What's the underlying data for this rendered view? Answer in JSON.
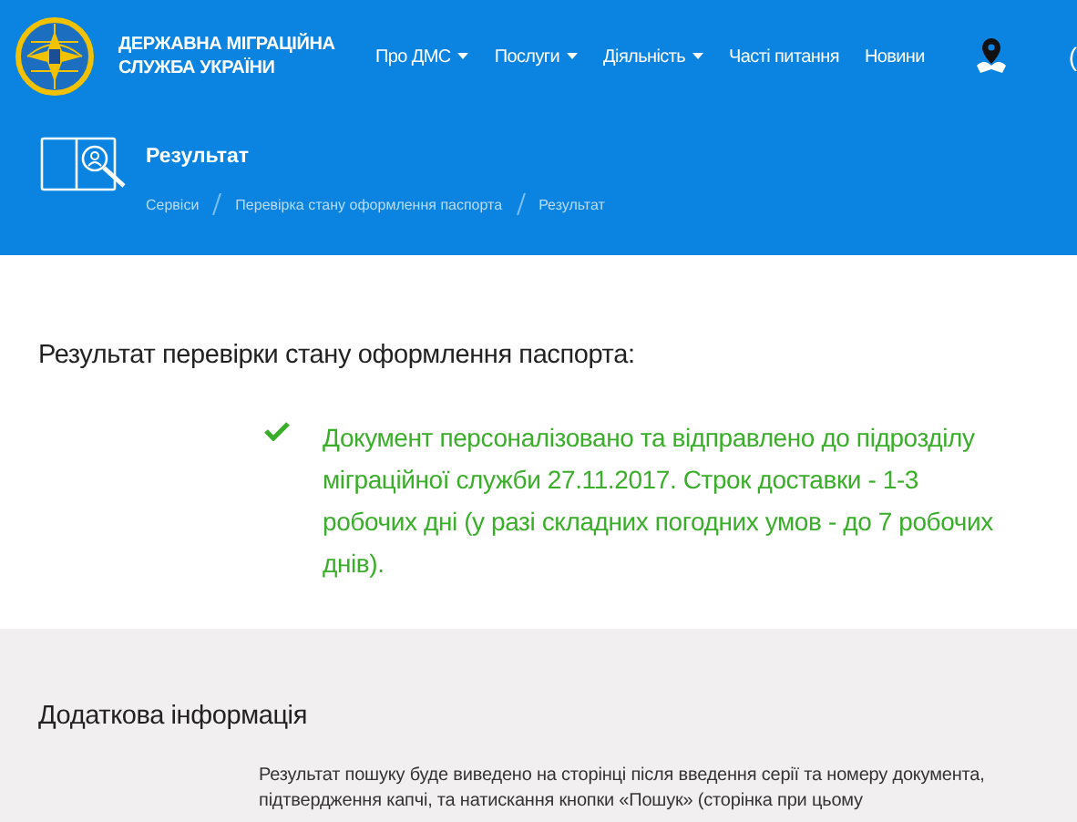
{
  "header": {
    "org_name": [
      "ДЕРЖАВНА МІГРАЦІЙНА",
      "СЛУЖБА УКРАЇНИ"
    ],
    "nav": [
      {
        "label": "Про ДМС",
        "dropdown": true
      },
      {
        "label": "Послуги",
        "dropdown": true
      },
      {
        "label": "Діяльність",
        "dropdown": true
      },
      {
        "label": "Часті питання",
        "dropdown": false
      },
      {
        "label": "Новини",
        "dropdown": false
      }
    ],
    "edge_text": "("
  },
  "page_title": "Результат",
  "breadcrumbs": [
    "Сервіси",
    "Перевірка стану оформлення паспорта",
    "Результат"
  ],
  "result": {
    "heading": "Результат перевірки стану оформлення паспорта:",
    "message": "Документ персоналізовано та відправлено до підрозділу міграційної служби 27.11.2017. Строк доставки - 1-3 робочих дні (у разі складних погодних умов - до 7 робочих днів)."
  },
  "info": {
    "heading": "Додаткова інформація",
    "text": "Результат пошуку буде виведено на сторінці після введення серії та номеру документа, підтвердження капчі, та натискання кнопки «Пошук» (сторінка при цьому"
  }
}
